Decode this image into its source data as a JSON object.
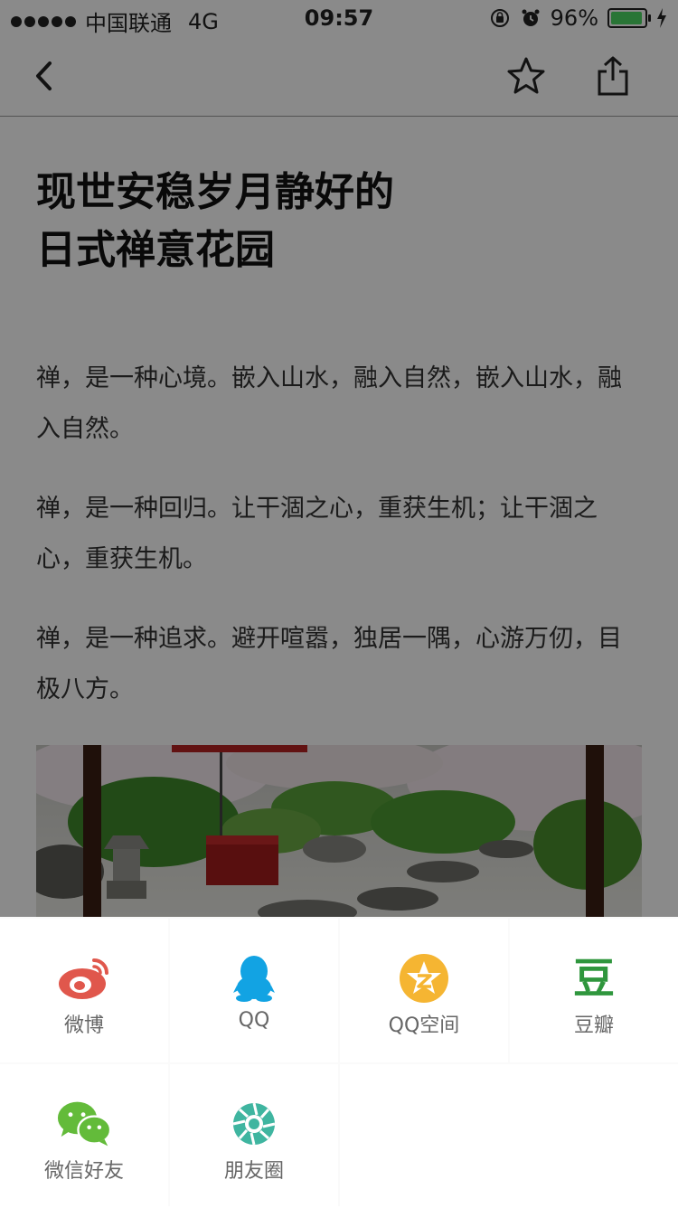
{
  "status_bar": {
    "carrier": "中国联通",
    "network": "4G",
    "time": "09:57",
    "battery_percent": "96%",
    "battery_level": 0.96,
    "icons": [
      "signal-dots-icon",
      "rotation-lock-icon",
      "alarm-icon",
      "battery-icon",
      "charging-bolt-icon"
    ]
  },
  "nav_bar": {
    "icons": [
      "back-chevron-icon",
      "star-icon",
      "share-icon"
    ]
  },
  "article": {
    "title_line1": "现世安稳岁月静好的",
    "title_line2": "日式禅意花园",
    "paragraphs": [
      "禅，是一种心境。嵌入山水，融入自然，嵌入山水，融入自然。",
      "禅，是一种回归。让干涸之心，重获生机；让干涸之心，重获生机。",
      "禅，是一种追求。避开喧嚣，独居一隅，心游万仞，目极八方。"
    ]
  },
  "share_sheet": {
    "items": [
      {
        "label": "微博",
        "icon": "weibo-icon",
        "color": "#e0574c"
      },
      {
        "label": "QQ",
        "icon": "qq-icon",
        "color": "#12a3e3"
      },
      {
        "label": "QQ空间",
        "icon": "qzone-icon",
        "color": "#f5b532"
      },
      {
        "label": "豆瓣",
        "icon": "douban-icon",
        "color": "#2f963d",
        "glyph": "豆"
      },
      {
        "label": "微信好友",
        "icon": "wechat-icon",
        "color": "#63bb3a"
      },
      {
        "label": "朋友圈",
        "icon": "moments-icon",
        "color": "#3fb5a0"
      }
    ]
  }
}
